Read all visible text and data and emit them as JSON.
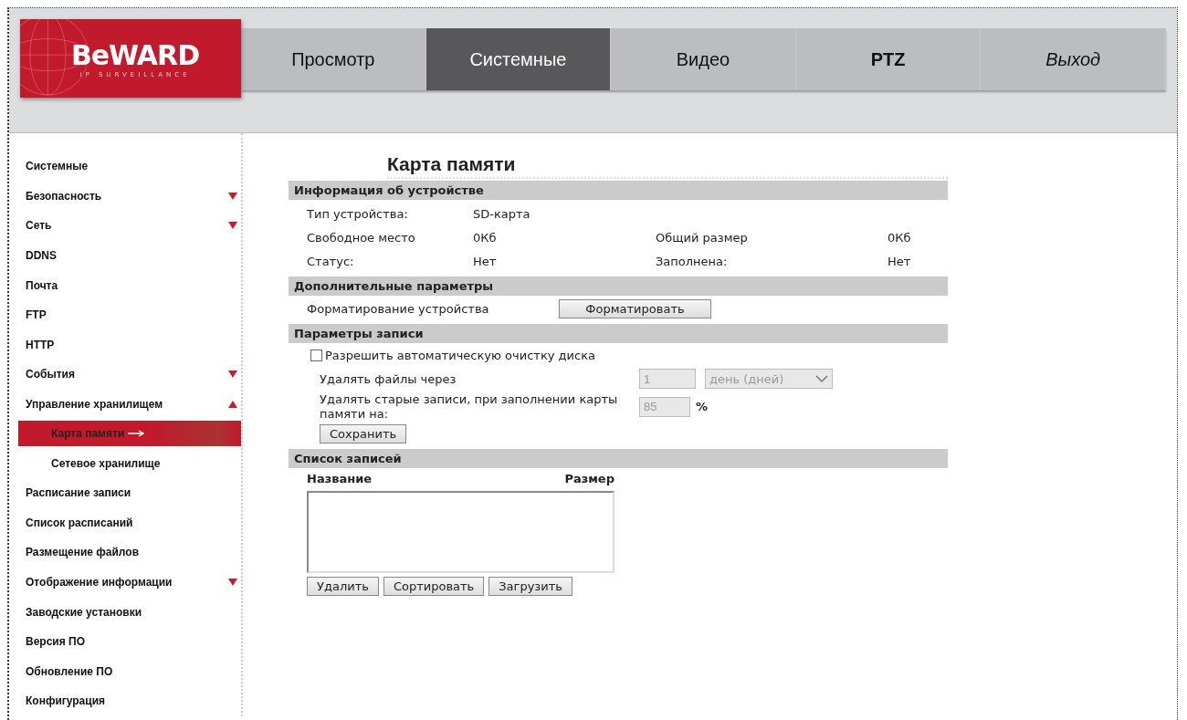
{
  "logo": {
    "brand": "BeWARD",
    "tagline": "IP SURVEILLANCE"
  },
  "tabs": [
    {
      "label": "Просмотр",
      "selected": false,
      "kind": "normal"
    },
    {
      "label": "Системные",
      "selected": true,
      "kind": "normal"
    },
    {
      "label": "Видео",
      "selected": false,
      "kind": "normal"
    },
    {
      "label": "PTZ",
      "selected": false,
      "kind": "bold"
    },
    {
      "label": "Выход",
      "selected": false,
      "kind": "italic"
    }
  ],
  "sidebar": {
    "items": [
      {
        "label": "Системные",
        "kind": "link",
        "selected": false
      },
      {
        "label": "Безопасность",
        "kind": "group",
        "selected": false,
        "expanded": false
      },
      {
        "label": "Сеть",
        "kind": "group",
        "selected": false,
        "expanded": false
      },
      {
        "label": "DDNS",
        "kind": "link",
        "selected": false
      },
      {
        "label": "Почта",
        "kind": "link",
        "selected": false
      },
      {
        "label": "FTP",
        "kind": "link",
        "selected": false
      },
      {
        "label": "HTTP",
        "kind": "link",
        "selected": false
      },
      {
        "label": "События",
        "kind": "group",
        "selected": false,
        "expanded": false
      },
      {
        "label": "Управление хранилищем",
        "kind": "group",
        "selected": false,
        "expanded": true,
        "children": [
          {
            "label": "Карта памяти",
            "selected": true
          },
          {
            "label": "Сетевое хранилище",
            "selected": false
          }
        ]
      },
      {
        "label": "Расписание записи",
        "kind": "link",
        "selected": false
      },
      {
        "label": "Список расписаний",
        "kind": "link",
        "selected": false
      },
      {
        "label": "Размещение файлов",
        "kind": "link",
        "selected": false
      },
      {
        "label": "Отображение информации",
        "kind": "group",
        "selected": false,
        "expanded": false
      },
      {
        "label": "Заводские установки",
        "kind": "link",
        "selected": false
      },
      {
        "label": "Версия ПО",
        "kind": "link",
        "selected": false
      },
      {
        "label": "Обновление ПО",
        "kind": "link",
        "selected": false
      },
      {
        "label": "Конфигурация",
        "kind": "link",
        "selected": false
      }
    ]
  },
  "page_title": "Карта памяти",
  "device_info": {
    "title": "Информация об устройстве",
    "rows": [
      [
        "Тип устройства:",
        "SD-карта"
      ],
      [
        "Свободное место",
        "0Кб",
        "Общий размер",
        "0Кб"
      ],
      [
        "Статус:",
        "Нет",
        "Заполнена:",
        "Нет"
      ]
    ]
  },
  "extra": {
    "title": "Дополнительные параметры",
    "label": "Форматирование устройства",
    "button": "Форматировать"
  },
  "record": {
    "title": "Параметры записи",
    "auto_clean": {
      "label": "Разрешить автоматическую очистку диска",
      "checked": false
    },
    "delete_after": {
      "label": "Удалять файлы через",
      "value": "1",
      "unit": "день (дней)"
    },
    "delete_old": {
      "label": "Удалять старые записи, при заполнении карты памяти на:",
      "value": "85",
      "unit": "%"
    },
    "button": "Сохранить"
  },
  "records_list": {
    "title": "Список записей",
    "columns": [
      "Название",
      "Размер"
    ],
    "buttons": [
      "Удалить",
      "Сортировать",
      "Загрузить"
    ]
  }
}
